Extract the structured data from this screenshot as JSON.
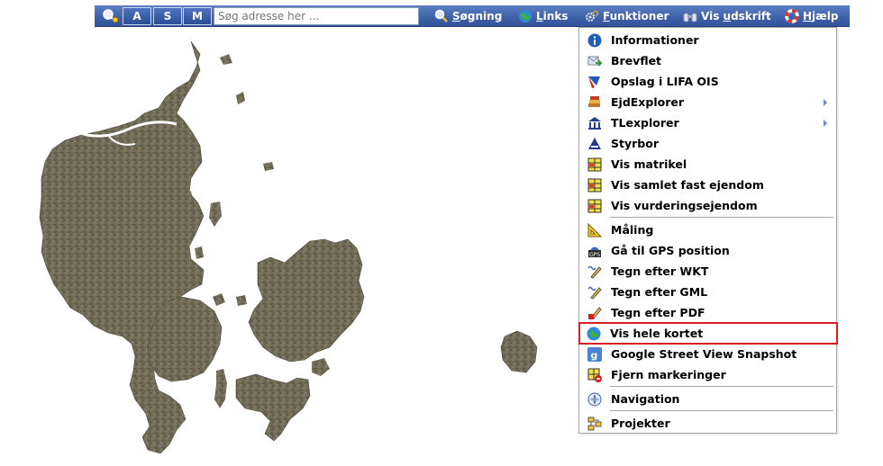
{
  "toolbar": {
    "mode_buttons": [
      "A",
      "S",
      "M"
    ],
    "search_placeholder": "Søg adresse her ...",
    "menus": [
      {
        "icon": "search-icon",
        "text": "Søgning",
        "underline": "S",
        "rest": "øgning"
      },
      {
        "icon": "globe-icon",
        "text": "Links",
        "underline": "L",
        "rest": "inks"
      },
      {
        "icon": "gears-icon",
        "text": "Funktioner",
        "underline": "F",
        "rest": "unktioner"
      },
      {
        "icon": "binoculars-icon",
        "text": "Vis udskrift",
        "pre": "Vis ",
        "underline": "u",
        "rest": "dskrift"
      },
      {
        "icon": "lifebuoy-icon",
        "text": "Hjælp",
        "underline": "H",
        "rest": "jælp"
      }
    ]
  },
  "dropdown": {
    "items": [
      {
        "label": "Informationer",
        "icon": "info-icon"
      },
      {
        "label": "Brevflet",
        "icon": "mail-merge-icon"
      },
      {
        "label": "Opslag i LIFA OIS",
        "icon": "lookup-icon"
      },
      {
        "label": "EjdExplorer",
        "icon": "books-icon",
        "submenu": true
      },
      {
        "label": "TLexplorer",
        "icon": "building-icon",
        "submenu": true
      },
      {
        "label": "Styrbor",
        "icon": "triangle-logo-icon"
      },
      {
        "label": "Vis matrikel",
        "icon": "parcel-grid-icon"
      },
      {
        "label": "Vis samlet fast ejendom",
        "icon": "parcel-grid-icon"
      },
      {
        "label": "Vis vurderingsejendom",
        "icon": "parcel-grid-icon"
      },
      {
        "label": "Måling",
        "icon": "ruler-icon"
      },
      {
        "label": "Gå til GPS position",
        "icon": "gps-icon"
      },
      {
        "label": "Tegn efter WKT",
        "icon": "draw-pen-icon"
      },
      {
        "label": "Tegn efter GML",
        "icon": "draw-pen-icon"
      },
      {
        "label": "Tegn efter PDF",
        "icon": "draw-pdf-icon"
      },
      {
        "label": "Vis hele kortet",
        "icon": "globe-icon",
        "highlighted": true
      },
      {
        "label": "Google Street View Snapshot",
        "icon": "google-icon"
      },
      {
        "label": "Fjern markeringer",
        "icon": "remove-marks-icon"
      },
      {
        "label": "Navigation",
        "icon": "compass-icon"
      },
      {
        "label": "Projekter",
        "icon": "projects-icon"
      }
    ]
  },
  "colors": {
    "toolbar": "#3d60a8",
    "highlight_border": "#d61f26",
    "land": "#6e6a55",
    "water_text": "#ffffff"
  }
}
